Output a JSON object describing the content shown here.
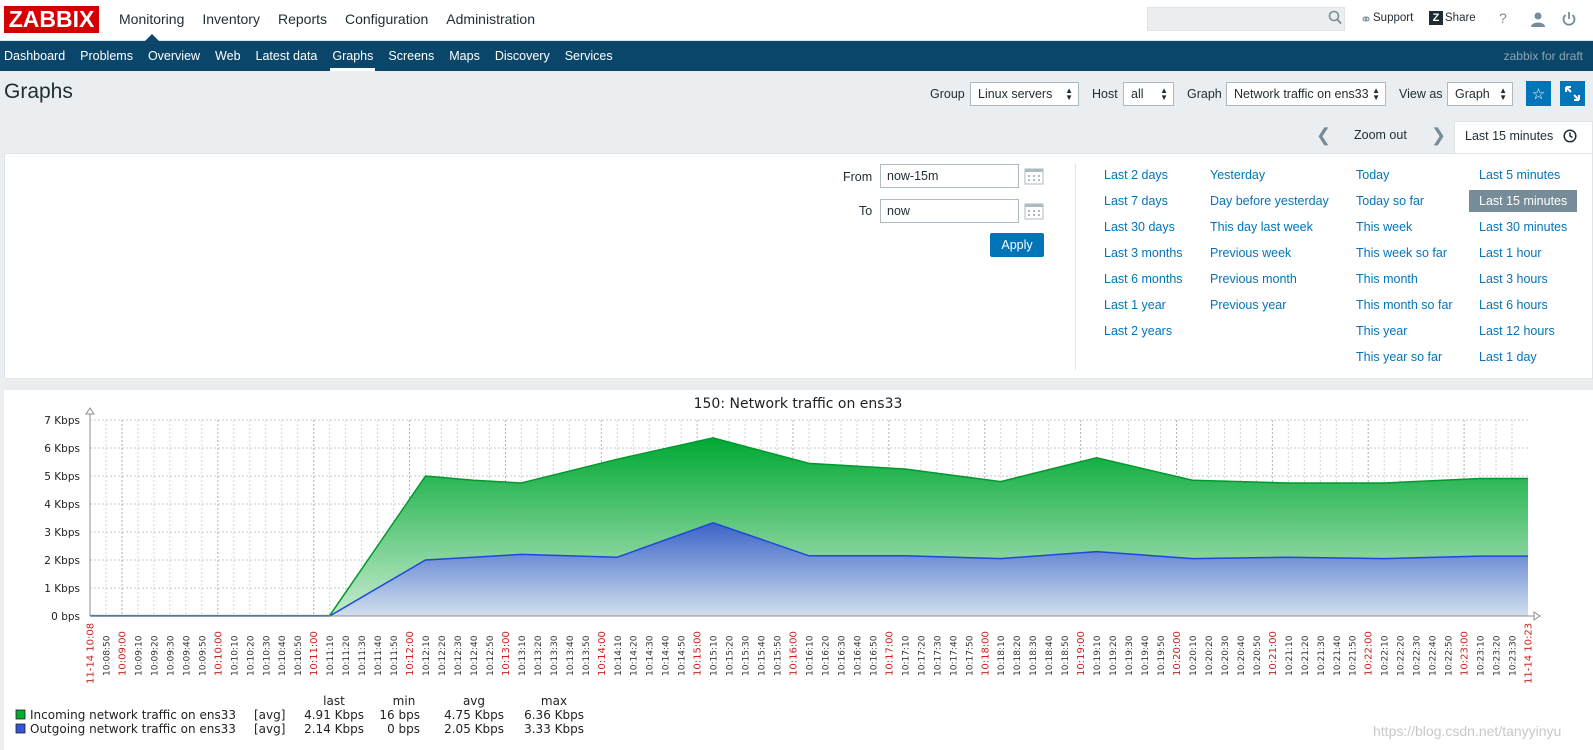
{
  "header": {
    "logo": "ZABBIX",
    "main_nav": [
      "Monitoring",
      "Inventory",
      "Reports",
      "Configuration",
      "Administration"
    ],
    "active_main": "Monitoring",
    "support": "Support",
    "share": "Share",
    "help": "?",
    "sub_nav": [
      "Dashboard",
      "Problems",
      "Overview",
      "Web",
      "Latest data",
      "Graphs",
      "Screens",
      "Maps",
      "Discovery",
      "Services"
    ],
    "active_sub": "Graphs",
    "server_name": "zabbix for draft"
  },
  "page": {
    "title": "Graphs",
    "group_label": "Group",
    "group_value": "Linux servers",
    "host_label": "Host",
    "host_value": "all",
    "graph_label": "Graph",
    "graph_value": "Network traffic on ens33",
    "viewas_label": "View as",
    "viewas_value": "Graph"
  },
  "time": {
    "zoom_out": "Zoom out",
    "active_tab": "Last 15 minutes",
    "from_label": "From",
    "from_value": "now-15m",
    "to_label": "To",
    "to_value": "now",
    "apply": "Apply",
    "quick": [
      [
        "Last 2 days",
        "Last 7 days",
        "Last 30 days",
        "Last 3 months",
        "Last 6 months",
        "Last 1 year",
        "Last 2 years"
      ],
      [
        "Yesterday",
        "Day before yesterday",
        "This day last week",
        "Previous week",
        "Previous month",
        "Previous year"
      ],
      [
        "Today",
        "Today so far",
        "This week",
        "This week so far",
        "This month",
        "This month so far",
        "This year",
        "This year so far"
      ],
      [
        "Last 5 minutes",
        "Last 15 minutes",
        "Last 30 minutes",
        "Last 1 hour",
        "Last 3 hours",
        "Last 6 hours",
        "Last 12 hours",
        "Last 1 day"
      ]
    ],
    "selected_quick": "Last 15 minutes"
  },
  "chart_data": {
    "type": "area",
    "title": "150: Network traffic on ens33",
    "y_ticks": [
      "0 bps",
      "1 Kbps",
      "2 Kbps",
      "3 Kbps",
      "4 Kbps",
      "5 Kbps",
      "6 Kbps",
      "7 Kbps"
    ],
    "ylim": [
      0,
      7
    ],
    "y_unit": "Kbps",
    "x_start_label": "11-14 10:08",
    "x_end_label": "11-14 10:23",
    "x_minor_labels": [
      "10:08:50",
      "10:09:00",
      "10:09:10",
      "10:09:20",
      "10:09:30",
      "10:09:40",
      "10:09:50",
      "10:10:00",
      "10:10:10",
      "10:10:20",
      "10:10:30",
      "10:10:40",
      "10:10:50",
      "10:11:00",
      "10:11:10",
      "10:11:20",
      "10:11:30",
      "10:11:40",
      "10:11:50",
      "10:12:00",
      "10:12:10",
      "10:12:20",
      "10:12:30",
      "10:12:40",
      "10:12:50",
      "10:13:00",
      "10:13:10",
      "10:13:20",
      "10:13:30",
      "10:13:40",
      "10:13:50",
      "10:14:00",
      "10:14:10",
      "10:14:20",
      "10:14:30",
      "10:14:40",
      "10:14:50",
      "10:15:00",
      "10:15:10",
      "10:15:20",
      "10:15:30",
      "10:15:40",
      "10:15:50",
      "10:16:00",
      "10:16:10",
      "10:16:20",
      "10:16:30",
      "10:16:40",
      "10:16:50",
      "10:17:00",
      "10:17:10",
      "10:17:20",
      "10:17:30",
      "10:17:40",
      "10:17:50",
      "10:18:00",
      "10:18:10",
      "10:18:20",
      "10:18:30",
      "10:18:40",
      "10:18:50",
      "10:19:00",
      "10:19:10",
      "10:19:20",
      "10:19:30",
      "10:19:40",
      "10:19:50",
      "10:20:00",
      "10:20:10",
      "10:20:20",
      "10:20:30",
      "10:20:40",
      "10:20:50",
      "10:21:00",
      "10:21:10",
      "10:21:20",
      "10:21:30",
      "10:21:40",
      "10:21:50",
      "10:22:00",
      "10:22:10",
      "10:22:20",
      "10:22:30",
      "10:22:40",
      "10:22:50",
      "10:23:00",
      "10:23:10",
      "10:23:20",
      "10:23:30"
    ],
    "x_major_labels": [
      "10:09:00",
      "10:10:00",
      "10:11:00",
      "10:12:00",
      "10:13:00",
      "10:14:00",
      "10:15:00",
      "10:16:00",
      "10:17:00",
      "10:18:00",
      "10:19:00",
      "10:20:00",
      "10:21:00",
      "10:22:00",
      "10:23:00"
    ],
    "series": [
      {
        "name": "Incoming network traffic on ens33",
        "color": "#00aa33",
        "x": [
          "10:08:40",
          "10:11:10",
          "10:12:10",
          "10:12:40",
          "10:13:10",
          "10:14:10",
          "10:15:10",
          "10:16:10",
          "10:17:10",
          "10:18:10",
          "10:19:10",
          "10:20:10",
          "10:21:10",
          "10:22:10",
          "10:23:10",
          "10:23:40"
        ],
        "values": [
          0.016,
          0.016,
          5.0,
          4.85,
          4.75,
          5.6,
          6.36,
          5.45,
          5.25,
          4.8,
          5.65,
          4.85,
          4.75,
          4.75,
          4.91,
          4.91
        ],
        "legend": {
          "func": "[avg]",
          "last": "4.91 Kbps",
          "min": "16 bps",
          "avg": "4.75 Kbps",
          "max": "6.36 Kbps"
        }
      },
      {
        "name": "Outgoing network traffic on ens33",
        "color": "#2050dd",
        "x": [
          "10:08:40",
          "10:11:10",
          "10:12:10",
          "10:12:40",
          "10:13:10",
          "10:14:10",
          "10:15:10",
          "10:16:10",
          "10:17:10",
          "10:18:10",
          "10:19:10",
          "10:20:10",
          "10:21:10",
          "10:22:10",
          "10:23:10",
          "10:23:40"
        ],
        "values": [
          0,
          0,
          2.0,
          2.1,
          2.2,
          2.1,
          3.33,
          2.15,
          2.15,
          2.05,
          2.3,
          2.05,
          2.1,
          2.05,
          2.14,
          2.14
        ],
        "legend": {
          "func": "[avg]",
          "last": "2.14 Kbps",
          "min": "0 bps",
          "avg": "2.05 Kbps",
          "max": "3.33 Kbps"
        }
      }
    ],
    "legend_headers": [
      "last",
      "min",
      "avg",
      "max"
    ]
  },
  "watermark": "https://blog.csdn.net/tanyyinyu"
}
